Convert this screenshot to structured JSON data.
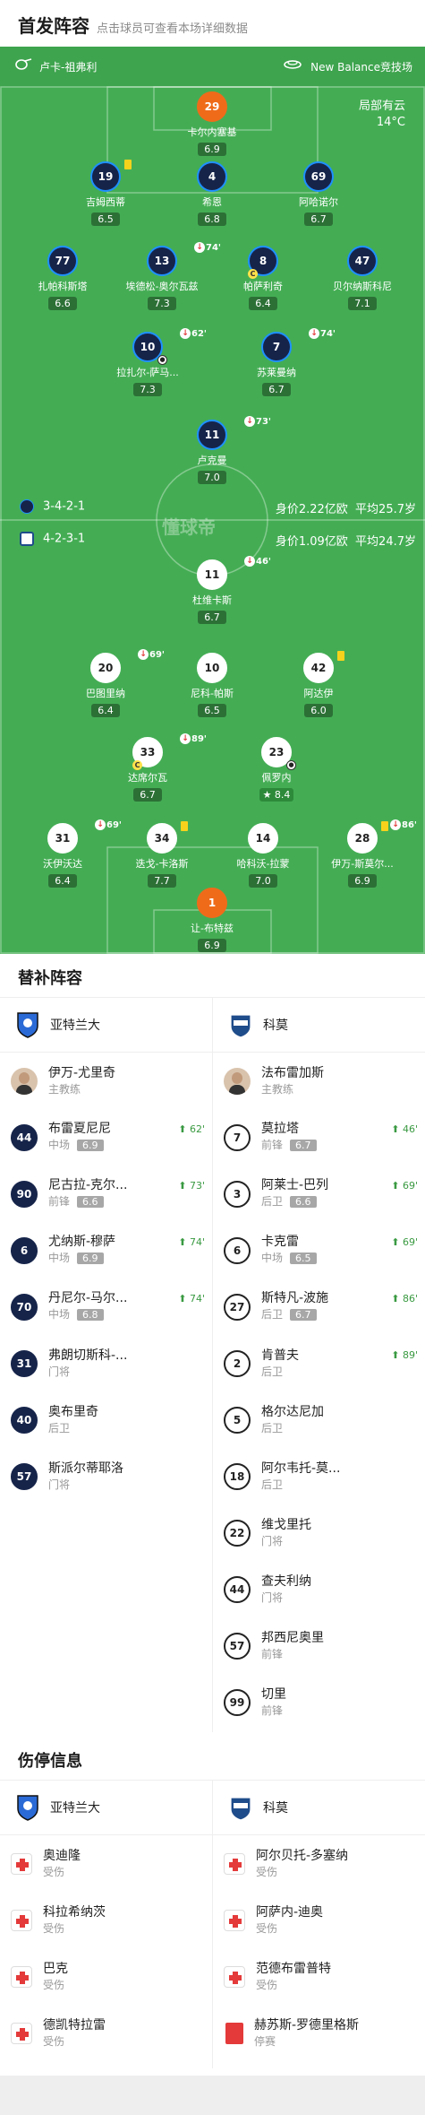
{
  "header": {
    "title": "首发阵容",
    "subtitle": "点击球员可查看本场详细数据"
  },
  "match": {
    "home_team": "卢卡-祖弗利",
    "away_team": "New Balance竞技场",
    "weather": {
      "text": "局部有云",
      "temp": "14°C"
    },
    "home": {
      "formation": "3-4-2-1",
      "value": "身价2.22亿欧",
      "age": "平均25.7岁"
    },
    "away": {
      "formation": "4-2-3-1",
      "value": "身价1.09亿欧",
      "age": "平均24.7岁"
    },
    "watermark": "懂球帝"
  },
  "players": {
    "h1": {
      "num": "29",
      "name": "卡尔内塞基",
      "rating": "6.9"
    },
    "h2": {
      "num": "19",
      "name": "吉姆西蒂",
      "rating": "6.5"
    },
    "h3": {
      "num": "4",
      "name": "希恩",
      "rating": "6.8"
    },
    "h4": {
      "num": "69",
      "name": "阿哈诺尔",
      "rating": "6.7"
    },
    "h5": {
      "num": "77",
      "name": "扎帕科斯塔",
      "rating": "6.6"
    },
    "h6": {
      "num": "13",
      "name": "埃德松-奥尔瓦兹",
      "rating": "7.3",
      "sub": "74'"
    },
    "h7": {
      "num": "8",
      "name": "帕萨利奇",
      "rating": "6.4"
    },
    "h8": {
      "num": "47",
      "name": "贝尔纳斯科尼",
      "rating": "7.1"
    },
    "h9": {
      "num": "10",
      "name": "拉扎尔-萨马...",
      "rating": "7.3",
      "sub": "62'"
    },
    "h10": {
      "num": "7",
      "name": "苏莱曼纳",
      "rating": "6.7",
      "sub": "74'"
    },
    "h11": {
      "num": "11",
      "name": "卢克曼",
      "rating": "7.0",
      "sub": "73'"
    },
    "a1": {
      "num": "11",
      "name": "杜维卡斯",
      "rating": "6.7",
      "sub": "46'"
    },
    "a2": {
      "num": "20",
      "name": "巴图里纳",
      "rating": "6.4",
      "sub": "69'"
    },
    "a3": {
      "num": "10",
      "name": "尼科-帕斯",
      "rating": "6.5"
    },
    "a4": {
      "num": "42",
      "name": "阿达伊",
      "rating": "6.0"
    },
    "a5": {
      "num": "33",
      "name": "达席尔瓦",
      "rating": "6.7",
      "sub": "89'"
    },
    "a6": {
      "num": "23",
      "name": "佩罗内",
      "rating": "8.4"
    },
    "a7": {
      "num": "31",
      "name": "沃伊沃达",
      "rating": "6.4",
      "sub": "69'"
    },
    "a8": {
      "num": "34",
      "name": "迭戈-卡洛斯",
      "rating": "7.7"
    },
    "a9": {
      "num": "14",
      "name": "哈科沃-拉蒙",
      "rating": "7.0"
    },
    "a10": {
      "num": "28",
      "name": "伊万-斯莫尔...",
      "rating": "6.9",
      "sub": "86'"
    },
    "a11": {
      "num": "1",
      "name": "让-布特兹",
      "rating": "6.9"
    }
  },
  "subs": {
    "title": "替补阵容",
    "home_name": "亚特兰大",
    "away_name": "科莫",
    "home": [
      {
        "num": "",
        "name": "伊万-尤里奇",
        "pos": "主教练",
        "rating": "",
        "in": ""
      },
      {
        "num": "44",
        "name": "布雷夏尼尼",
        "pos": "中场",
        "rating": "6.9",
        "in": "62'"
      },
      {
        "num": "90",
        "name": "尼古拉-克尔...",
        "pos": "前锋",
        "rating": "6.6",
        "in": "73'"
      },
      {
        "num": "6",
        "name": "尤纳斯-穆萨",
        "pos": "中场",
        "rating": "6.9",
        "in": "74'"
      },
      {
        "num": "70",
        "name": "丹尼尔-马尔...",
        "pos": "中场",
        "rating": "6.8",
        "in": "74'"
      },
      {
        "num": "31",
        "name": "弗朗切斯科-...",
        "pos": "门将",
        "rating": "",
        "in": ""
      },
      {
        "num": "40",
        "name": "奥布里奇",
        "pos": "后卫",
        "rating": "",
        "in": ""
      },
      {
        "num": "57",
        "name": "斯派尔蒂耶洛",
        "pos": "门将",
        "rating": "",
        "in": ""
      }
    ],
    "away": [
      {
        "num": "",
        "name": "法布雷加斯",
        "pos": "主教练",
        "rating": "",
        "in": ""
      },
      {
        "num": "7",
        "name": "莫拉塔",
        "pos": "前锋",
        "rating": "6.7",
        "in": "46'"
      },
      {
        "num": "3",
        "name": "阿莱士-巴列",
        "pos": "后卫",
        "rating": "6.6",
        "in": "69'"
      },
      {
        "num": "6",
        "name": "卡克雷",
        "pos": "中场",
        "rating": "6.5",
        "in": "69'"
      },
      {
        "num": "27",
        "name": "斯特凡-波施",
        "pos": "后卫",
        "rating": "6.7",
        "in": "86'"
      },
      {
        "num": "2",
        "name": "肯普夫",
        "pos": "后卫",
        "rating": "",
        "in": "89'"
      },
      {
        "num": "5",
        "name": "格尔达尼加",
        "pos": "后卫",
        "rating": "",
        "in": ""
      },
      {
        "num": "18",
        "name": "阿尔韦托-莫...",
        "pos": "后卫",
        "rating": "",
        "in": ""
      },
      {
        "num": "22",
        "name": "维戈里托",
        "pos": "门将",
        "rating": "",
        "in": ""
      },
      {
        "num": "44",
        "name": "查夫利纳",
        "pos": "门将",
        "rating": "",
        "in": ""
      },
      {
        "num": "57",
        "name": "邦西尼奥里",
        "pos": "前锋",
        "rating": "",
        "in": ""
      },
      {
        "num": "99",
        "name": "切里",
        "pos": "前锋",
        "rating": "",
        "in": ""
      }
    ]
  },
  "injuries": {
    "title": "伤停信息",
    "home": [
      {
        "name": "奥迪隆",
        "status": "受伤"
      },
      {
        "name": "科拉希纳茨",
        "status": "受伤"
      },
      {
        "name": "巴克",
        "status": "受伤"
      },
      {
        "name": "德凯特拉雷",
        "status": "受伤"
      }
    ],
    "away": [
      {
        "name": "阿尔贝托-多塞纳",
        "status": "受伤"
      },
      {
        "name": "阿萨内-迪奥",
        "status": "受伤"
      },
      {
        "name": "范德布雷普特",
        "status": "受伤"
      },
      {
        "name": "赫苏斯-罗德里格斯",
        "status": "停赛"
      }
    ]
  },
  "colors": {
    "pitch": "#44ad54",
    "home_kit": "#16244a",
    "away_kit": "#ffffff",
    "goalkeeper": "#ef6b1a"
  }
}
